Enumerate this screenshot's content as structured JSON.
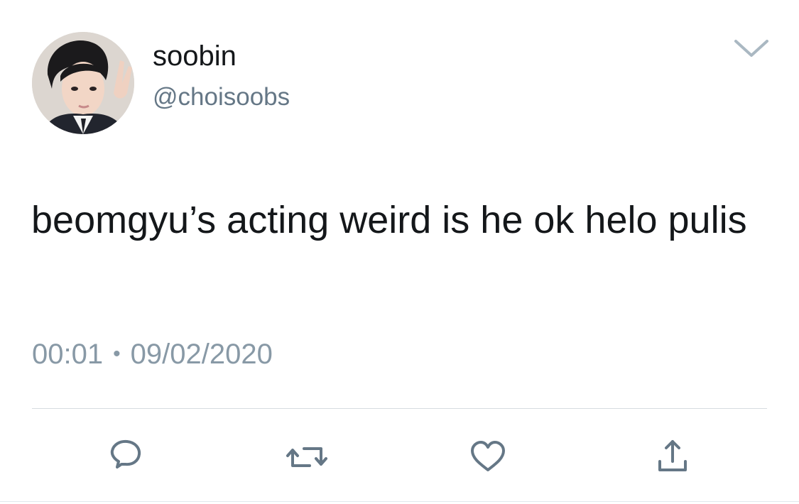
{
  "user": {
    "display_name": "soobin",
    "handle": "@choisoobs"
  },
  "tweet": {
    "text": "beomgyu’s acting weird is he ok helo pulis",
    "time": "00:01",
    "separator": "•",
    "date": "09/02/2020"
  },
  "actions": [
    {
      "name": "reply",
      "icon": "reply-icon"
    },
    {
      "name": "retweet",
      "icon": "retweet-icon"
    },
    {
      "name": "like",
      "icon": "heart-icon"
    },
    {
      "name": "share",
      "icon": "share-icon"
    }
  ],
  "colors": {
    "text_primary": "#14171a",
    "text_secondary": "#657786",
    "meta_gray": "#8899a6",
    "icon_gray": "#657786",
    "divider": "#d6dbe0"
  }
}
